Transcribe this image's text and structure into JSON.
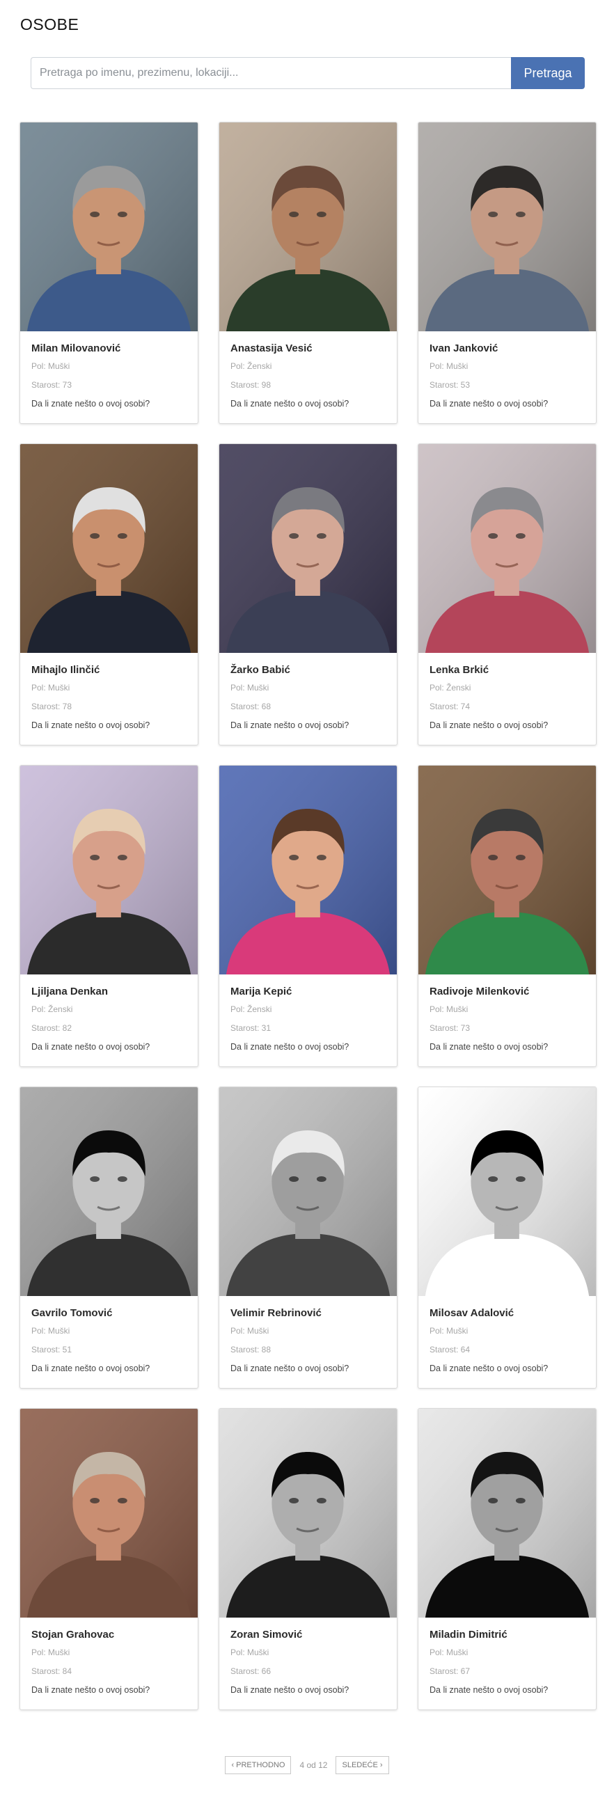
{
  "page": {
    "title": "OSOBE"
  },
  "search": {
    "placeholder": "Pretraga po imenu, prezimenu, lokaciji...",
    "button_label": "Pretraga"
  },
  "persons": [
    {
      "name": "Milan Milovanović",
      "gender": "Pol: Muški",
      "age": "Starost: 73",
      "question": "Da li znate nešto o ovoj osobi?",
      "photo": {
        "bg": "#6b7f8c",
        "skin": "#c99574",
        "hair": "#9b9b9b",
        "shirt": "#3d5a8a",
        "mono": false
      }
    },
    {
      "name": "Anastasija Vesić",
      "gender": "Pol: Ženski",
      "age": "Starost: 98",
      "question": "Da li znate nešto o ovoj osobi?",
      "photo": {
        "bg": "#b9a692",
        "skin": "#b48262",
        "hair": "#6b4a3a",
        "shirt": "#2a3d2a",
        "mono": false
      }
    },
    {
      "name": "Ivan Janković",
      "gender": "Pol: Muški",
      "age": "Starost: 53",
      "question": "Da li znate nešto o ovoj osobi?",
      "photo": {
        "bg": "#a9a5a2",
        "skin": "#c59a84",
        "hair": "#2d2a28",
        "shirt": "#5b6a80",
        "mono": false
      }
    },
    {
      "name": "Mihajlo Ilinčić",
      "gender": "Pol: Muški",
      "age": "Starost: 78",
      "question": "Da li znate nešto o ovoj osobi?",
      "photo": {
        "bg": "#6a4a2e",
        "skin": "#c9906e",
        "hair": "#e0e0e0",
        "shirt": "#1e2330",
        "mono": false
      }
    },
    {
      "name": "Žarko Babić",
      "gender": "Pol: Muški",
      "age": "Starost: 68",
      "question": "Da li znate nešto o ovoj osobi?",
      "photo": {
        "bg": "#3a3550",
        "skin": "#d4a896",
        "hair": "#7a7a80",
        "shirt": "#3b3f55",
        "mono": false
      }
    },
    {
      "name": "Lenka Brkić",
      "gender": "Pol: Ženski",
      "age": "Starost: 74",
      "question": "Da li znate nešto o ovoj osobi?",
      "photo": {
        "bg": "#c8bcc0",
        "skin": "#d6a398",
        "hair": "#8a8a8e",
        "shirt": "#b4455a",
        "mono": false
      }
    },
    {
      "name": "Ljiljana Denkan",
      "gender": "Pol: Ženski",
      "age": "Starost: 82",
      "question": "Da li znate nešto o ovoj osobi?",
      "photo": {
        "bg": "#c7b9d8",
        "skin": "#d7a08a",
        "hair": "#e6cdb2",
        "shirt": "#2b2b2b",
        "mono": false
      }
    },
    {
      "name": "Marija Kepić",
      "gender": "Pol: Ženski",
      "age": "Starost: 31",
      "question": "Da li znate nešto o ovoj osobi?",
      "photo": {
        "bg": "#4a64b0",
        "skin": "#e0a98a",
        "hair": "#5a3a28",
        "shirt": "#d93a7a",
        "mono": false
      }
    },
    {
      "name": "Radivoje Milenković",
      "gender": "Pol: Muški",
      "age": "Starost: 73",
      "question": "Da li znate nešto o ovoj osobi?",
      "photo": {
        "bg": "#7a5a3c",
        "skin": "#b87a66",
        "hair": "#3a3a3a",
        "shirt": "#2f8a4a",
        "mono": false
      }
    },
    {
      "name": "Gavrilo Tomović",
      "gender": "Pol: Muški",
      "age": "Starost: 51",
      "question": "Da li znate nešto o ovoj osobi?",
      "photo": {
        "bg": "#9a9a9a",
        "skin": "#bdbdbd",
        "hair": "#1a1a1a",
        "shirt": "#3a3a3a",
        "mono": true
      }
    },
    {
      "name": "Velimir Rebrinović",
      "gender": "Pol: Muški",
      "age": "Starost: 88",
      "question": "Da li znate nešto o ovoj osobi?",
      "photo": {
        "bg": "#b5b5b5",
        "skin": "#9a9a9a",
        "hair": "#dcdcdc",
        "shirt": "#4a4a4a",
        "mono": true
      }
    },
    {
      "name": "Milosav Adalović",
      "gender": "Pol: Muški",
      "age": "Starost: 64",
      "question": "Da li znate nešto o ovoj osobi?",
      "photo": {
        "bg": "#ededed",
        "skin": "#b0b0b0",
        "hair": "#111111",
        "shirt": "#f5f5f5",
        "mono": true
      }
    },
    {
      "name": "Stojan Grahovac",
      "gender": "Pol: Muški",
      "age": "Starost: 84",
      "question": "Da li znate nešto o ovoj osobi?",
      "photo": {
        "bg": "#8a5a46",
        "skin": "#c98e72",
        "hair": "#c4b6a6",
        "shirt": "#6e4a3a",
        "mono": false
      }
    },
    {
      "name": "Zoran Simović",
      "gender": "Pol: Muški",
      "age": "Starost: 66",
      "question": "Da li znate nešto o ovoj osobi?",
      "photo": {
        "bg": "#cfcfcf",
        "skin": "#a8a8a8",
        "hair": "#1a1a1a",
        "shirt": "#2a2a2a",
        "mono": true
      }
    },
    {
      "name": "Miladin Dimitrić",
      "gender": "Pol: Muški",
      "age": "Starost: 67",
      "question": "Da li znate nešto o ovoj osobi?",
      "photo": {
        "bg": "#d6d6d6",
        "skin": "#9c9c9c",
        "hair": "#222222",
        "shirt": "#1a1a1a",
        "mono": true
      }
    }
  ],
  "pagination": {
    "prev_label": "PRETHODNO",
    "info": "4 od 12",
    "next_label": "SLEDEĆE",
    "prev_icon": "chevron-left-icon",
    "next_icon": "chevron-right-icon"
  }
}
